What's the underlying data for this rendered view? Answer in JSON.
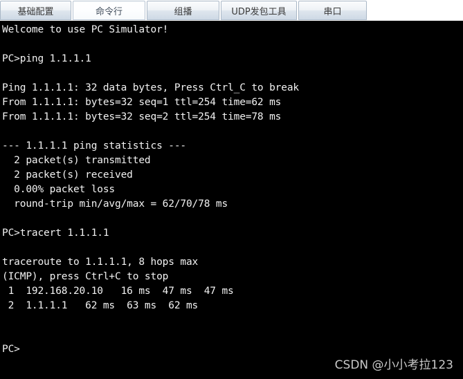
{
  "window": {
    "title": "PC Simulator"
  },
  "tabs": {
    "selected_index": 1,
    "items": [
      {
        "label": "基础配置",
        "width": 103
      },
      {
        "label": "命令行",
        "width": 105
      },
      {
        "label": "组播",
        "width": 105
      },
      {
        "label": "UDP发包工具",
        "width": 110
      },
      {
        "label": "串口",
        "width": 99
      }
    ]
  },
  "terminal": {
    "background_color": "#000000",
    "text_color": "#f2f2f2",
    "lines": [
      "Welcome to use PC Simulator!",
      "",
      "PC>ping 1.1.1.1",
      "",
      "Ping 1.1.1.1: 32 data bytes, Press Ctrl_C to break",
      "From 1.1.1.1: bytes=32 seq=1 ttl=254 time=62 ms",
      "From 1.1.1.1: bytes=32 seq=2 ttl=254 time=78 ms",
      "",
      "--- 1.1.1.1 ping statistics ---",
      "  2 packet(s) transmitted",
      "  2 packet(s) received",
      "  0.00% packet loss",
      "  round-trip min/avg/max = 62/70/78 ms",
      "",
      "PC>tracert 1.1.1.1",
      "",
      "traceroute to 1.1.1.1, 8 hops max",
      "(ICMP), press Ctrl+C to stop",
      " 1  192.168.20.10   16 ms  47 ms  47 ms",
      " 2  1.1.1.1   62 ms  63 ms  62 ms",
      "",
      "",
      "PC>"
    ]
  },
  "watermark": {
    "text": "CSDN @小小考拉123",
    "color": "#c9c9c9"
  }
}
